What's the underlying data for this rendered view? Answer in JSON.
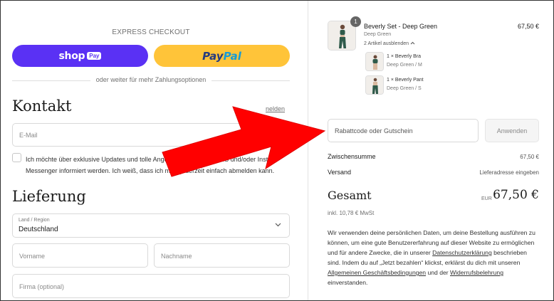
{
  "express": {
    "title": "EXPRESS CHECKOUT",
    "shop_word": "shop",
    "shop_pay": "Pay",
    "paypal_1": "Pay",
    "paypal_2": "Pal",
    "divider": "oder weiter für mehr Zahlungsoptionen"
  },
  "contact": {
    "heading": "Kontakt",
    "login_link": "nelden",
    "email_placeholder": "E-Mail",
    "consent": "Ich möchte über exklusive Updates und tolle Angebote per E-Mail, SMS und/oder Instant Messenger informiert werden. Ich weiß, dass ich mich jederzeit einfach abmelden kann."
  },
  "delivery": {
    "heading": "Lieferung",
    "country_label": "Land / Region",
    "country_value": "Deutschland",
    "first_name": "Vorname",
    "last_name": "Nachname",
    "company": "Firma (optional)"
  },
  "order": {
    "product_name": "Beverly Set - Deep Green",
    "product_variant": "Deep Green",
    "product_toggle": "2 Artikel ausblenden",
    "product_price": "67,50 €",
    "quantity": "1",
    "sub_items": [
      {
        "name": "1 × Beverly Bra",
        "variant": "Deep Green / M"
      },
      {
        "name": "1 × Beverly Pant",
        "variant": "Deep Green / S"
      }
    ],
    "discount_placeholder": "Rabattcode oder Gutschein",
    "apply_label": "Anwenden",
    "subtotal_label": "Zwischensumme",
    "subtotal_value": "67,50 €",
    "shipping_label": "Versand",
    "shipping_value": "Lieferadresse eingeben",
    "total_label": "Gesamt",
    "total_currency": "EUR",
    "total_value": "67,50 €",
    "tax_note": "inkl. 10,78 € MwSt",
    "legal_1": "Wir verwenden deine persönlichen Daten, um deine Bestellung ausführen zu können, um eine gute Benutzererfahrung auf dieser Website zu ermöglichen und für andere Zwecke, die in unserer ",
    "legal_privacy": "Datenschutzerklärung",
    "legal_2": " beschrieben sind. Indem du auf „Jetzt bezahlen“ klickst, erklärst du dich mit unseren ",
    "legal_terms": "Allgemeinen Geschäftsbedingungen",
    "legal_3": " und der ",
    "legal_withdrawal": "Widerrufsbelehrung",
    "legal_4": " einverstanden."
  },
  "colors": {
    "shop_purple": "#5a31f4",
    "paypal_yellow": "#ffc439",
    "arrow_red": "#ff0000"
  }
}
